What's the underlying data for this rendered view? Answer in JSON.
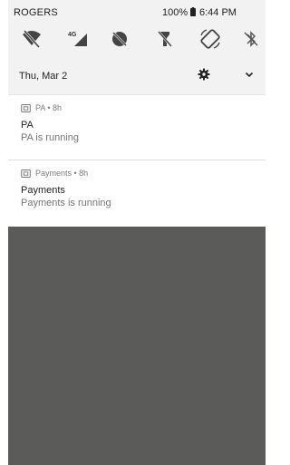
{
  "status_bar": {
    "carrier": "ROGERS",
    "battery_percent": "100%",
    "time": "6:44 PM"
  },
  "quick_settings": {
    "tiles": [
      {
        "name": "wifi-off-icon"
      },
      {
        "name": "mobile-data-4g-icon",
        "badge": "4G"
      },
      {
        "name": "do-not-disturb-icon"
      },
      {
        "name": "flashlight-off-icon"
      },
      {
        "name": "auto-rotate-icon"
      },
      {
        "name": "bluetooth-off-icon"
      }
    ],
    "date": "Thu, Mar 2"
  },
  "notifications": [
    {
      "app": "PA",
      "age": "8h",
      "header": "PA • 8h",
      "title": "PA",
      "text": "PA is running"
    },
    {
      "app": "Payments",
      "age": "8h",
      "header": "Payments • 8h",
      "title": "Payments",
      "text": "Payments is running"
    }
  ],
  "colors": {
    "quick_settings_bg": "#f2f2f2",
    "wallpaper": "#5b5c5a",
    "secondary_text": "#757575"
  }
}
